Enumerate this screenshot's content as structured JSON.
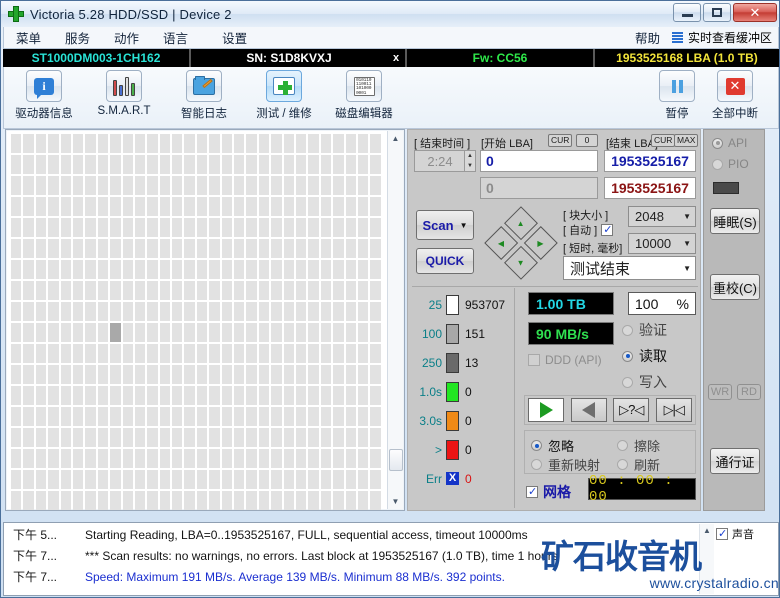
{
  "window": {
    "title": "Victoria 5.28 HDD/SSD | Device 2",
    "app_icon": "green-cross-icon",
    "minimize": "–",
    "maximize": "□",
    "close": "✕"
  },
  "menubar": {
    "items": [
      {
        "label": "菜单",
        "name": "menu-item-main"
      },
      {
        "label": "服务",
        "name": "menu-item-service"
      },
      {
        "label": "动作",
        "name": "menu-item-action"
      },
      {
        "label": "语言",
        "name": "menu-item-language"
      },
      {
        "label": "设置",
        "name": "menu-item-settings"
      },
      {
        "label": "帮助",
        "name": "menu-item-help"
      }
    ],
    "buffer_view": "实时查看缓冲区"
  },
  "drive_bar": {
    "model": "ST1000DM003-1CH162",
    "serial": "SN: S1D8KVXJ",
    "x_mark": "x",
    "firmware": "Fw: CC56",
    "capacity": "1953525168 LBA (1.0 TB)",
    "colors": {
      "model": "#29e3d6",
      "serial": "#ffffff",
      "firmware": "#2ee84a",
      "capacity": "#f2e43a"
    }
  },
  "toolbar": {
    "items": [
      {
        "label": "驱动器信息",
        "icon": "drive-info-icon",
        "selected": false
      },
      {
        "label": "S.M.A.R.T",
        "icon": "smart-bars-icon",
        "selected": false
      },
      {
        "label": "智能日志",
        "icon": "smart-log-folder-icon",
        "selected": false
      },
      {
        "label": "测试 / 维修",
        "icon": "test-repair-kit-icon",
        "selected": true
      },
      {
        "label": "磁盘编辑器",
        "icon": "disk-editor-hex-icon",
        "selected": false
      }
    ],
    "pause": {
      "label": "暂停",
      "icon": "pause-icon"
    },
    "stop_all": {
      "label": "全部中断",
      "icon": "stop-all-icon"
    }
  },
  "map": {
    "total_cells": 563,
    "used_cell_index": 278,
    "cell_color": "#e2e2e2",
    "used_color": "#a9a9a9"
  },
  "controls": {
    "end_time_label": "[ 结束时间 ]",
    "end_time_value": "2:24",
    "start_lba_label": "[开始 LBA]",
    "start_lba_cur": "CUR",
    "start_lba_zero": "0",
    "start_lba_value": "0",
    "start_lba_second": "0",
    "end_lba_label": "[结束 LBA]",
    "end_lba_cur": "CUR",
    "end_lba_max": "MAX",
    "end_lba_value": "1953525167",
    "end_lba_second": "1953525167",
    "scan_button": "Scan",
    "quick_button": "QUICK",
    "block_size_label": "[ 块大小 ]",
    "auto_label": "[ 自动 ]",
    "auto_checked": true,
    "block_size_value": "2048",
    "timeout_label": "[ 短时, 毫秒]",
    "timeout_value": "10000",
    "status_select": "测试结束",
    "dpad": "direction-pad"
  },
  "stats": {
    "rows": [
      {
        "threshold": "25",
        "color": "#ffffff",
        "count": "953707",
        "name": "stat-row-25ms"
      },
      {
        "threshold": "100",
        "color": "#a8a8a8",
        "count": "151",
        "name": "stat-row-100ms"
      },
      {
        "threshold": "250",
        "color": "#6a6a6a",
        "count": "13",
        "name": "stat-row-250ms"
      },
      {
        "threshold": "1.0s",
        "color": "#22e622",
        "count": "0",
        "name": "stat-row-1s"
      },
      {
        "threshold": "3.0s",
        "color": "#f08a16",
        "count": "0",
        "name": "stat-row-3s"
      },
      {
        "threshold": ">",
        "color": "#ec1414",
        "count": "0",
        "name": "stat-row-over"
      }
    ],
    "err_label": "Err",
    "err_count": "0"
  },
  "readout": {
    "capacity": "1.00 TB",
    "percent": "100",
    "percent_symbol": "%",
    "speed": "90 MB/s",
    "ddd_label": "DDD (API)",
    "ddd_checked": false,
    "modes": [
      {
        "label": "验证",
        "selected": false,
        "name": "mode-verify"
      },
      {
        "label": "读取",
        "selected": true,
        "name": "mode-read"
      },
      {
        "label": "写入",
        "selected": false,
        "name": "mode-write"
      }
    ],
    "transport": [
      {
        "glyph": "play",
        "name": "start-button",
        "active": true
      },
      {
        "glyph": "back",
        "name": "reverse-button",
        "active": false
      },
      {
        "glyph": "▷?◁",
        "name": "random-button",
        "active": false
      },
      {
        "glyph": "▷|◁",
        "name": "butterfly-button",
        "active": false
      }
    ],
    "actions": [
      {
        "label": "忽略",
        "selected": true,
        "name": "action-ignore"
      },
      {
        "label": "擦除",
        "selected": false,
        "name": "action-erase"
      },
      {
        "label": "重新映射",
        "selected": false,
        "name": "action-remap"
      },
      {
        "label": "刷新",
        "selected": false,
        "name": "action-refresh"
      }
    ],
    "grid_label": "网格",
    "grid_checked": true,
    "timer": "00 : 00 : 00"
  },
  "rail": {
    "api_label": "API",
    "api_selected": true,
    "pio_label": "PIO",
    "pio_selected": false,
    "sleep_button": "睡眠(S)",
    "recalibrate_button": "重校(C)",
    "wr_button": "WR",
    "rd_button": "RD",
    "passport_button": "通行证"
  },
  "log": {
    "rows": [
      {
        "time": "下午 5...",
        "message": "Starting Reading, LBA=0..1953525167, FULL, sequential access, timeout 10000ms",
        "style": "normal"
      },
      {
        "time": "下午 7...",
        "message": "*** Scan results: no warnings, no errors. Last block at 1953525167 (1.0 TB), time 1 hours",
        "style": "normal"
      },
      {
        "time": "下午 7...",
        "message": "Speed: Maximum 191 MB/s. Average 139 MB/s. Minimum 88 MB/s. 392 points.",
        "style": "blue"
      }
    ],
    "sound_label": "声音",
    "sound_checked": true
  },
  "watermark": {
    "cn": "矿石收音机",
    "url": "www.crystalradio.cn"
  }
}
